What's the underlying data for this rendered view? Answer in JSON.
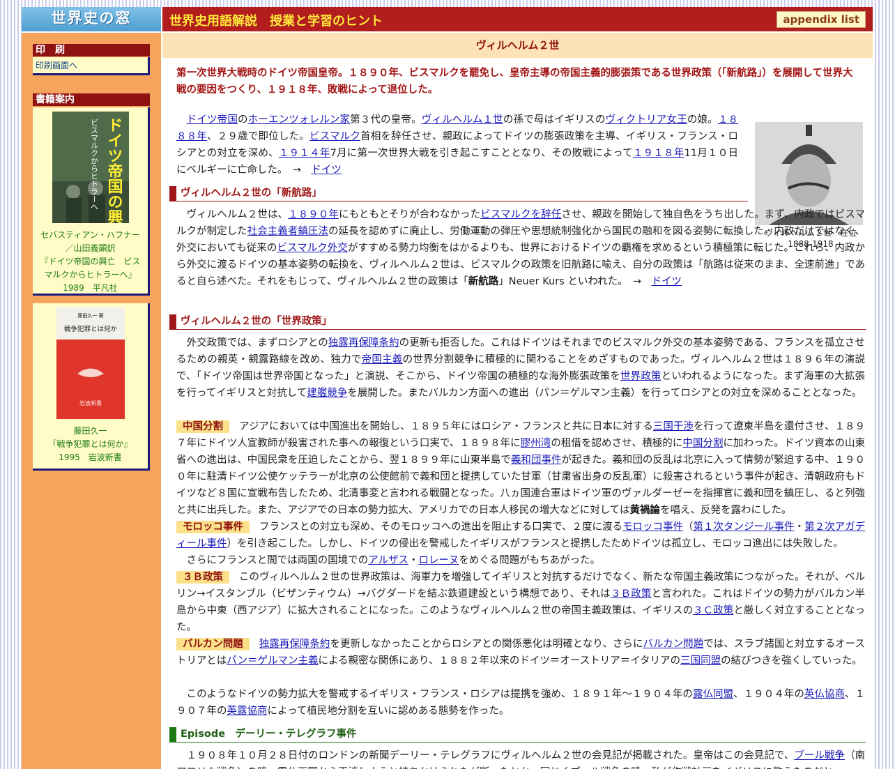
{
  "header": {
    "logo": "世界史の窓",
    "title": "世界史用語解説　授業と学習のヒント",
    "appendix_button": "appendix list"
  },
  "sidebar": {
    "print": {
      "title": "印　刷",
      "link": "印刷画面へ"
    },
    "books": {
      "title": "書籍案内",
      "book1": {
        "cover_title": "ドイツ帝国の興亡",
        "cover_subtitle": "ビスマルクからヒトラーへ",
        "author": "セバスティアン・ハフナー／山田義顕訳",
        "title": "『ドイツ帝国の興亡　ビスマルクからヒトラーへ』",
        "year_publisher": "1989　平凡社"
      },
      "book2": {
        "cover_author": "藤田久一 著",
        "cover_title": "戦争犯罪とは何か",
        "cover_publisher": "岩波新書",
        "author": "藤田久一",
        "title": "『戦争犯罪とは何か』",
        "year_publisher": "1995　岩波新書"
      }
    }
  },
  "main": {
    "page_title": "ヴィルヘルム２世",
    "lead": "第一次世界大戦時のドイツ帝国皇帝。１８９０年、ビスマルクを罷免し、皇帝主導の帝国主義的膨張策である世界政策（「新航路」）を展開して世界大戦の要因をつくり、１９１８年、敗戦によって退位した。",
    "portrait_caption": {
      "line1": "ヴィルヘルム２世　在位",
      "line2": "1888-1918"
    },
    "intro": {
      "l1": "ドイツ帝国",
      "t1": "の",
      "l2": "ホーエンツォレルン家",
      "t2": "第３代の皇帝。",
      "l3": "ヴィルヘルム１世",
      "t3": "の孫で母はイギリスの",
      "l4": "ヴィクトリア女王",
      "t4": "の娘。",
      "l5": "１８８８年",
      "t5": "、２９歳で即位した。",
      "l6": "ビスマルク",
      "t6": "首相を辞任させ、親政によってドイツの膨張政策を主導、イギリス・フランス・ロシアとの対立を深め、",
      "l7": "１９１４年",
      "t7": "7月に第一次世界大戦を引き起こすこととなり、その敗戦によって",
      "l8": "１９１８年",
      "t8": "11月１０日にベルギーに亡命した。　→　",
      "l9": "ドイツ"
    },
    "sections": {
      "s1": "ヴィルヘルム２世の「新航路」",
      "s2": "ヴィルヘルム２世の「世界政策」",
      "s3": "Episode　デーリー・テレグラフ事件"
    },
    "p_newcourse": {
      "t1": "ヴィルヘルム２世は、",
      "l1": "１８９０年",
      "t2": "にもともとそりが合わなかった",
      "l2": "ビスマルクを辞任",
      "t3": "させ、親政を開始して独自色をうち出した。まず、内政ではビスマルクが制定した",
      "l3": "社会主義者鎮圧法",
      "t4": "の延長を認めずに廃止し、労働運動の弾圧や思想統制強化から国民の融和を図る姿勢に転換した。内政だけではなく、外交においても従来の",
      "l4": "ビスマルク外交",
      "t5": "がすすめる勢力均衡をはかるよりも、世界におけるドイツの覇権を求めるという積極策に転じた。これら、内政から外交に渡るドイツの基本姿勢の転換を、ヴィルヘルム２世は、ビスマルクの政策を旧航路に喩え、自分の政策は「航路は従来のまま、全速前進」であると自ら述べた。それをもじって、ヴィルヘルム２世の政策は「",
      "b1": "新航路",
      "t6": "」Neuer Kurs といわれた。　→　",
      "l5": "ドイツ"
    },
    "p_world": {
      "t1": "外交政策では、まずロシアとの",
      "l1": "独露再保障条約",
      "t2": "の更新も拒否した。これはドイツはそれまでのビスマルク外交の基本姿勢である、フランスを孤立させるための親英・親露路線を改め、独力で",
      "l2": "帝国主義",
      "t3": "の世界分割競争に積極的に関わることをめざすものであった。ヴィルヘルム２世は１８９６年の演説で、「ドイツ帝国は世界帝国となった」と演説、そこから、ドイツ帝国の積極的な海外膨張政策を",
      "l3": "世界政策",
      "t4": "といわれるようになった。まず海軍の大拡張を行ってイギリスと対抗して",
      "l4": "建艦競争",
      "t5": "を展開した。またバルカン方面への進出（パン＝ゲルマン主義）を行ってロシアとの対立を深めることとなった。"
    },
    "p_china": {
      "tag": "中国分割",
      "t1": "アジアにおいては中国進出を開始し、１８９５年にはロシア・フランスと共に日本に対する",
      "l1": "三国干渉",
      "t2": "を行って遼東半島を還付させ、１８９７年にドイツ人宣教師が殺害された事への報復という口実で、１８９８年に",
      "l2": "膠州湾",
      "t3": "の租借を認めさせ、積極的に",
      "l3": "中国分割",
      "t4": "に加わった。ドイツ資本の山東省への進出は、中国民衆を圧迫したことから、翌１８９９年に山東半島で",
      "l4": "義和団事件",
      "t5": "が起きた。義和団の反乱は北京に入って情勢が緊迫する中、１９００年に駐清ドイツ公使ケッテラーが北京の公使館前で義和団と提携していた甘軍（甘粛省出身の反乱軍）に殺害されるという事件が起き、清朝政府もドイツなど８国に宣戦布告したため、北清事変と言われる戦闘となった。八ヵ国連合軍はドイツ軍のヴァルダーゼーを指揮官に義和団を鎮圧し、ると列強と共に出兵した。また、アジアでの日本の勢力拡大、アメリカでの日本人移民の増大などに対しては",
      "b1": "黄禍論",
      "t6": "を唱え、反発を露わにした。"
    },
    "p_morocco": {
      "tag": "モロッコ事件",
      "t1": "フランスとの対立も深め、そのモロッコへの進出を阻止する口実で、２度に渡る",
      "l1": "モロッコ事件",
      "t2": "（",
      "l2": "第１次タンジール事件",
      "t3": "・",
      "l3": "第２次アガディール事件",
      "t4": "）を引き起こした。しかし、ドイツの侵出を警戒したイギリスがフランスと提携したためドイツは孤立し、モロッコ進出には失敗した。"
    },
    "p_alsace": {
      "t1": "さらにフランスと間では両国の国境での",
      "l1": "アルザス",
      "t2": "・",
      "l2": "ロレーヌ",
      "t3": "をめぐる問題がもちあがった。"
    },
    "p_3b": {
      "tag": "３Ｂ政策",
      "t1": "このヴィルヘルム２世の世界政策は、海軍力を増強してイギリスと対抗するだけでなく、新たな帝国主義政策につながった。それが、ベルリン→イスタンブル（ビザンティウム）→バグダードを結ぶ鉄道建設という構想であり、それは",
      "l1": "３Ｂ政策",
      "t2": "と言われた。これはドイツの勢力がバルカン半島から中東（西アジア）に拡大されることになった。このようなヴィルヘルム２世の帝国主義政策は、イギリスの",
      "l2": "３Ｃ政策",
      "t3": "と厳しく対立することとなった。"
    },
    "p_balkan": {
      "tag": "バルカン問題",
      "l1": "独露再保障条約",
      "t1": "を更新しなかったことからロシアとの関係悪化は明確となり、さらに",
      "l2": "バルカン問題",
      "t2": "では、スラブ諸国と対立するオーストリアとは",
      "l3": "パン＝ゲルマン主義",
      "t3": "による親密な関係にあり、１８８２年以来のドイツ＝オーストリア＝イタリアの",
      "l4": "三国同盟",
      "t4": "の結びつきを強くしていった。"
    },
    "p_alliance": {
      "t1": "このようなドイツの勢力拡大を警戒するイギリス・フランス・ロシアは提携を強め、１８９１年～１９０４年の",
      "l1": "露仏同盟",
      "t2": "、１９０４年の",
      "l2": "英仏協商",
      "t3": "、１９０７年の",
      "l3": "英露協商",
      "t4": "によって植民地分割を互いに認めある態勢を作った。"
    },
    "p_episode": {
      "t1": "１９０８年１０月２８日付のロンドンの新聞デーリー・テレグラフにヴィルヘルム２世の会見記が掲載された。皇帝はこの会見記で、",
      "l1": "ブール戦争",
      "t2": "（南アフリカ戦争）の時、露仏両国から干渉しようと持ちかけられたが断ったとか、同じくブール戦争の時、私が作戦計画をイギリスに教えたのだと"
    }
  }
}
